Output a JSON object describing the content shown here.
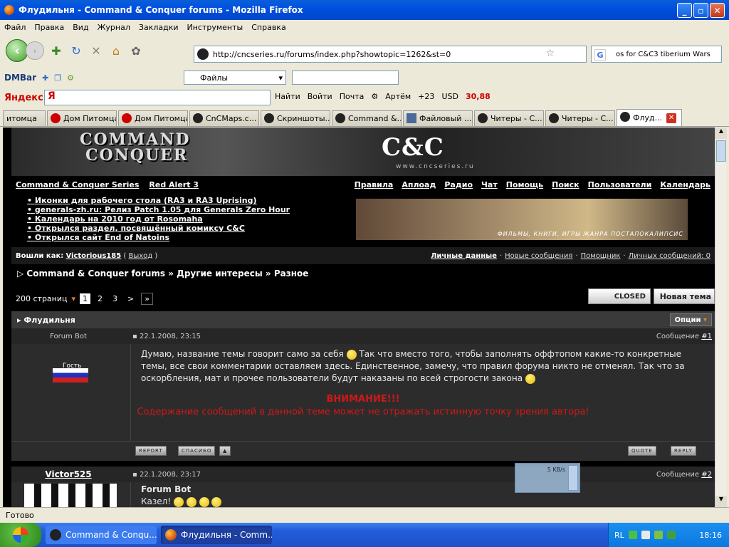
{
  "window": {
    "title": "Флудильня - Command & Conquer forums - Mozilla Firefox"
  },
  "menu": [
    "Файл",
    "Правка",
    "Вид",
    "Журнал",
    "Закладки",
    "Инструменты",
    "Справка"
  ],
  "nav": {
    "url": "http://cncseries.ru/forums/index.php?showtopic=1262&st=0",
    "search_text": "os for C&C3 tiberium Wars"
  },
  "dmbar": {
    "label": "DMBar",
    "files": "Файлы"
  },
  "yandex": {
    "label": "Яндекс",
    "find": "Найти",
    "login": "Войти",
    "mail": "Почта",
    "user": "Артём",
    "weather": "+23",
    "currency": "USD",
    "rate": "30,88"
  },
  "tabs": [
    {
      "label": "итомца",
      "icon": "red"
    },
    {
      "label": "Дом Питомца",
      "icon": "red"
    },
    {
      "label": "Дом Питомца",
      "icon": "red"
    },
    {
      "label": "CnCMaps.c...",
      "icon": "dark"
    },
    {
      "label": "Скриншоты...",
      "icon": "dark"
    },
    {
      "label": "Command &...",
      "icon": "dark"
    },
    {
      "label": "Файловый ...",
      "icon": "f"
    },
    {
      "label": "Читеры - С...",
      "icon": "dark"
    },
    {
      "label": "Читеры - С...",
      "icon": "dark"
    },
    {
      "label": "Флуд...",
      "icon": "dark"
    }
  ],
  "banner": {
    "logo_line1": "COMMAND",
    "logo_line2": "CONQUER",
    "cnc": "C&C",
    "site": "www.cncseries.ru"
  },
  "toplinks": {
    "left": [
      "Command & Conquer Series",
      "Red Alert 3"
    ],
    "right": [
      "Правила",
      "Аплоад",
      "Радио",
      "Чат",
      "Помощь",
      "Поиск",
      "Пользователи",
      "Календарь"
    ]
  },
  "news": [
    "Иконки для рабочего стола (RA3 и RA3 Uprising)",
    "generals-zh.ru: Релиз Patch 1.05 для Generals Zero Hour",
    "Календарь на 2010 год от Rosomaha",
    "Открылся раздел, посвящённый комиксу C&C",
    "Открылся сайт End of Natoins"
  ],
  "ad_text": "ФИЛЬМЫ, КНИГИ, ИГРЫ ЖАНРА ПОСТАПОКАЛИПСИС",
  "userbar": {
    "logged": "Вошли как:",
    "user": "Victorious185",
    "logout": "Выход",
    "links": [
      "Личные данные",
      "Новые сообщения",
      "Помощник",
      "Личных сообщений: 0"
    ]
  },
  "breadcrumb": "Command & Conquer forums » Другие интересы » Разное",
  "pages": {
    "label": "200 страниц",
    "items": [
      "1",
      "2",
      "3",
      ">",
      "»"
    ]
  },
  "buttons": {
    "closed": "CLOSED",
    "new_topic": "Новая тема",
    "options": "Опции"
  },
  "thread": {
    "title": "Флудильня"
  },
  "post1": {
    "author": "Forum Bot",
    "date": "22.1.2008, 23:15",
    "num_label": "Сообщение",
    "num": "#1",
    "rank": "Гость",
    "text": "Думаю, название темы говорит само за себя",
    "text2": " Так что вместо того, чтобы заполнять оффтопом какие-то конкретные темы, все свои комментарии оставляем здесь. Единственное, замечу, что правил форума никто не отменял. Так что за оскорбления, мат и прочее пользователи будут наказаны по всей строгости закона",
    "warn1": "ВНИМАНИЕ!!!",
    "warn2": "Содержание сообщений в данной теме может не отражать истинную точку зрения автора!"
  },
  "post_btns": {
    "report": "REPORT",
    "thanks": "СПАСИБО",
    "quote": "QUOTE",
    "reply": "REPLY"
  },
  "post2": {
    "author": "Victor525",
    "date": "22.1.2008, 23:17",
    "num_label": "Сообщение",
    "num": "#2",
    "quote_author": "Forum Bot",
    "text": "Казел!"
  },
  "netmon": "5 KB/s",
  "status": "Готово",
  "taskbar": {
    "tasks": [
      "Command & Conqu...",
      "Флудильня - Comm..."
    ],
    "lang": "RL",
    "clock": "18:16"
  }
}
